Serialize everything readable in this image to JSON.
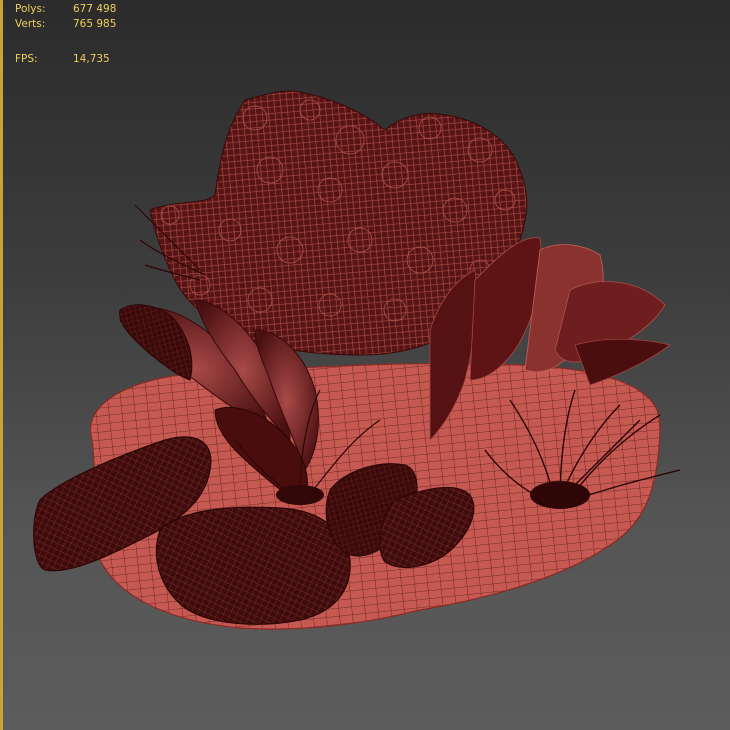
{
  "viewport": {
    "stats": {
      "polys_label": "Polys:",
      "polys_value": "677 498",
      "verts_label": "Verts:",
      "verts_value": "765 985",
      "fps_label": "FPS:",
      "fps_value": "14,735"
    },
    "render_mode": "wireframe",
    "colors": {
      "stats_text": "#f0ce5c",
      "active_border": "#c9a23c",
      "wire_light": "#c86058",
      "wire_dark": "#3a0808",
      "foliage": "#5a1616",
      "background_top": "#2b2b2b",
      "background_bottom": "#5c5c5c"
    }
  }
}
